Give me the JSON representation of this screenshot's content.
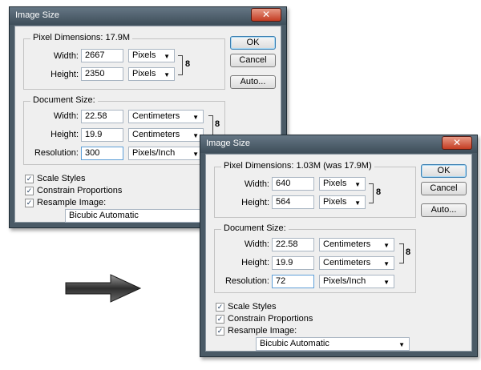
{
  "dialog_before": {
    "title": "Image Size",
    "close_glyph": "✕",
    "pixel_dimensions": {
      "label": "Pixel Dimensions:",
      "value": "17.9M",
      "width_label": "Width:",
      "width": "2667",
      "width_unit": "Pixels",
      "height_label": "Height:",
      "height": "2350",
      "height_unit": "Pixels"
    },
    "document_size": {
      "label": "Document Size:",
      "width_label": "Width:",
      "width": "22.58",
      "width_unit": "Centimeters",
      "height_label": "Height:",
      "height": "19.9",
      "height_unit": "Centimeters",
      "resolution_label": "Resolution:",
      "resolution": "300",
      "resolution_unit": "Pixels/Inch"
    },
    "buttons": {
      "ok": "OK",
      "cancel": "Cancel",
      "auto": "Auto..."
    },
    "checkboxes": {
      "scale_styles": "Scale Styles",
      "constrain": "Constrain Proportions",
      "resample": "Resample Image:"
    },
    "resample_method": "Bicubic Automatic"
  },
  "dialog_after": {
    "title": "Image Size",
    "close_glyph": "✕",
    "pixel_dimensions": {
      "label": "Pixel Dimensions:",
      "value": "1.03M (was 17.9M)",
      "width_label": "Width:",
      "width": "640",
      "width_unit": "Pixels",
      "height_label": "Height:",
      "height": "564",
      "height_unit": "Pixels"
    },
    "document_size": {
      "label": "Document Size:",
      "width_label": "Width:",
      "width": "22.58",
      "width_unit": "Centimeters",
      "height_label": "Height:",
      "height": "19.9",
      "height_unit": "Centimeters",
      "resolution_label": "Resolution:",
      "resolution": "72",
      "resolution_unit": "Pixels/Inch"
    },
    "buttons": {
      "ok": "OK",
      "cancel": "Cancel",
      "auto": "Auto..."
    },
    "checkboxes": {
      "scale_styles": "Scale Styles",
      "constrain": "Constrain Proportions",
      "resample": "Resample Image:"
    },
    "resample_method": "Bicubic Automatic"
  },
  "icons": {
    "checkmark": "✓",
    "chain": "8",
    "caret": "▼"
  },
  "colors": {
    "titlebar": "#4a5a66",
    "close_button": "#c43c22",
    "ok_border": "#3c7fb1",
    "arrow": "#3c3c3c"
  }
}
